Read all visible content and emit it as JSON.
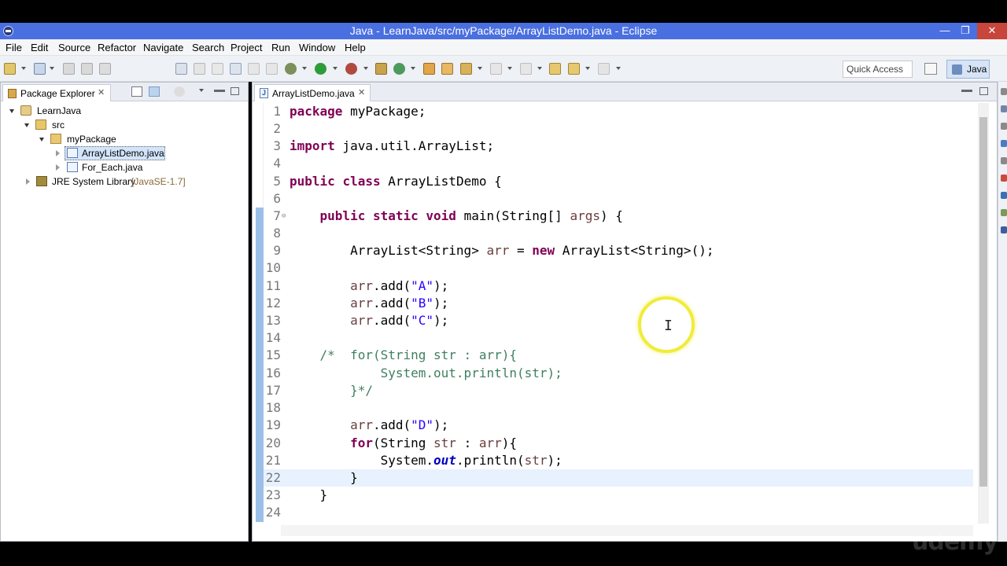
{
  "window": {
    "title": "Java - LearnJava/src/myPackage/ArrayListDemo.java - Eclipse",
    "minimize": "—",
    "maximize": "❐",
    "close": "✕"
  },
  "menu": [
    "File",
    "Edit",
    "Source",
    "Refactor",
    "Navigate",
    "Search",
    "Project",
    "Run",
    "Window",
    "Help"
  ],
  "toolbar": {
    "quick_access": "Quick Access",
    "perspective": "Java"
  },
  "package_explorer": {
    "tab_label": "Package Explorer",
    "tree": {
      "project": "LearnJava",
      "src": "src",
      "package": "myPackage",
      "file1": "ArrayListDemo.java",
      "file2": "For_Each.java",
      "jre": "JRE System Library",
      "jre_version": "[JavaSE-1.7]"
    }
  },
  "editor": {
    "tab_label": "ArrayListDemo.java",
    "line_numbers": [
      "1",
      "2",
      "3",
      "4",
      "5",
      "6",
      "7",
      "8",
      "9",
      "10",
      "11",
      "12",
      "13",
      "14",
      "15",
      "16",
      "17",
      "18",
      "19",
      "20",
      "21",
      "22",
      "23",
      "24"
    ],
    "code": {
      "l1_kw": "package",
      "l1_rest": " myPackage;",
      "l3_kw": "import",
      "l3_rest": " java.util.ArrayList;",
      "l5_kw1": "public",
      "l5_kw2": "class",
      "l5_rest": " ArrayListDemo {",
      "l7_kw1": "public",
      "l7_kw2": "static",
      "l7_kw3": "void",
      "l7_rest1": " main(String[] ",
      "l7_var": "args",
      "l7_rest2": ") {",
      "l9_a": "ArrayList<String> ",
      "l9_var": "arr",
      "l9_b": " = ",
      "l9_kw": "new",
      "l9_c": " ArrayList<String>();",
      "l11_var": "arr",
      "l11_a": ".add(",
      "l11_str": "\"A\"",
      "l11_b": ");",
      "l12_var": "arr",
      "l12_a": ".add(",
      "l12_str": "\"B\"",
      "l12_b": ");",
      "l13_var": "arr",
      "l13_a": ".add(",
      "l13_str": "\"C\"",
      "l13_b": ");",
      "l15": "/*  for(String str : arr){",
      "l16": "        System.out.println(str);",
      "l17": "    }*/",
      "l19_var": "arr",
      "l19_a": ".add(",
      "l19_str": "\"D\"",
      "l19_b": ");",
      "l20_kw": "for",
      "l20_a": "(String ",
      "l20_var1": "str",
      "l20_b": " : ",
      "l20_var2": "arr",
      "l20_c": "){",
      "l21_a": "System.",
      "l21_fld": "out",
      "l21_b": ".println(",
      "l21_var": "str",
      "l21_c": ");",
      "l22": "}",
      "l23": "}"
    }
  },
  "watermark": "udemy",
  "colors": {
    "keyword": "#7f0055",
    "string": "#2a00ff",
    "comment": "#3f7f5f",
    "titlebar": "#4a6fe0",
    "halo": "#f0ec3a"
  }
}
